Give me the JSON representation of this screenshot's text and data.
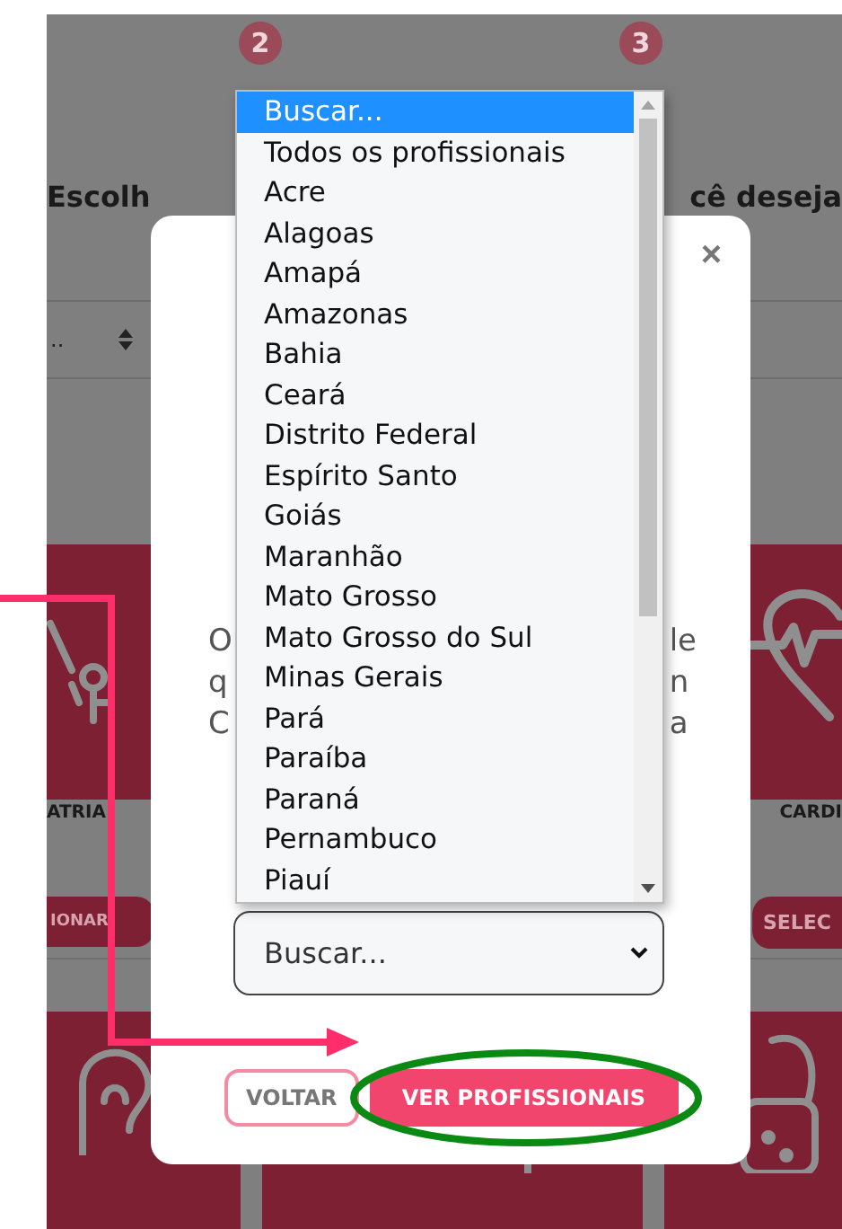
{
  "steps": [
    "2",
    "3"
  ],
  "heading": {
    "left": "Escolh",
    "right": "cê deseja"
  },
  "filter": {
    "value": ".."
  },
  "cards": [
    {
      "label": "ATRIA",
      "button": "IONAR"
    },
    {
      "label": "CARDI",
      "button": "SELEC"
    }
  ],
  "modal": {
    "close": "×",
    "text_left": [
      "O",
      "q",
      "C"
    ],
    "text_right": [
      "le",
      "n",
      "a"
    ],
    "select": {
      "value": "Buscar..."
    },
    "buttons": [
      {
        "label": "VOLTAR",
        "kind": "outline"
      },
      {
        "label": "VER PROFISSIONAIS",
        "kind": "primary"
      }
    ]
  },
  "dropdown": {
    "options": [
      {
        "label": "Buscar...",
        "selected": true
      },
      {
        "label": "Todos os profissionais",
        "selected": false
      },
      {
        "label": "Acre",
        "selected": false
      },
      {
        "label": "Alagoas",
        "selected": false
      },
      {
        "label": "Amapá",
        "selected": false
      },
      {
        "label": "Amazonas",
        "selected": false
      },
      {
        "label": "Bahia",
        "selected": false
      },
      {
        "label": "Ceará",
        "selected": false
      },
      {
        "label": "Distrito Federal",
        "selected": false
      },
      {
        "label": "Espírito Santo",
        "selected": false
      },
      {
        "label": "Goiás",
        "selected": false
      },
      {
        "label": "Maranhão",
        "selected": false
      },
      {
        "label": "Mato Grosso",
        "selected": false
      },
      {
        "label": "Mato Grosso do Sul",
        "selected": false
      },
      {
        "label": "Minas Gerais",
        "selected": false
      },
      {
        "label": "Pará",
        "selected": false
      },
      {
        "label": "Paraíba",
        "selected": false
      },
      {
        "label": "Paraná",
        "selected": false
      },
      {
        "label": "Pernambuco",
        "selected": false
      },
      {
        "label": "Piauí",
        "selected": false
      }
    ]
  }
}
